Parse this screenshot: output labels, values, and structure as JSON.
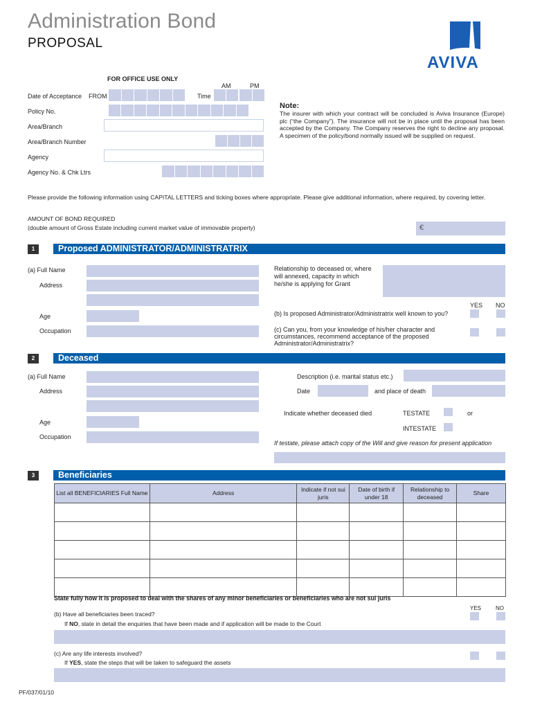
{
  "header": {
    "title": "Administration Bond",
    "subtitle": "PROPOSAL",
    "logo_text": "AVIVA",
    "brand_color": "#1a5fb4"
  },
  "office_use": {
    "heading": "FOR OFFICE USE ONLY",
    "date_of_acceptance_label": "Date of Acceptance",
    "from_label": "FROM",
    "time_label": "Time",
    "am_label": "AM",
    "pm_label": "PM",
    "policy_no_label": "Policy No.",
    "area_branch_label": "Area/Branch",
    "area_branch_number_label": "Area/Branch Number",
    "agency_label": "Agency",
    "agency_no_label": "Agency No. & Chk Ltrs"
  },
  "note": {
    "heading": "Note:",
    "body": "The insurer with which your contract will be concluded is Aviva Insurance (Europe) plc (“the Company”). The insurance will not be in place until the proposal has been accepted by the Company. The Company reserves the right to decline any proposal. A specimen of the policy/bond normally issued will be supplied on request."
  },
  "intro": {
    "text": "Please provide the following information using CAPITAL LETTERS and ticking boxes where appropriate. Please give additional information, where required, by covering letter.",
    "bond_amount_label": "AMOUNT OF BOND REQUIRED",
    "bond_amount_sub": "(double amount of Gross Estate including current market value of immovable property)",
    "currency_symbol": "€"
  },
  "section1": {
    "number": "1",
    "title": "Proposed ADMINISTRATOR/ADMINISTRATRIX",
    "full_name_label": "(a)  Full Name",
    "address_label": "Address",
    "age_label": "Age",
    "occupation_label": "Occupation",
    "relationship_label": "Relationship to deceased or, where will annexed, capacity in which he/she is applying for Grant",
    "yes_label": "YES",
    "no_label": "NO",
    "q_b": "(b) Is proposed Administrator/Administratrix well known to you?",
    "q_c": "(c) Can you, from your knowledge of his/her character and circumstances, recommend acceptance of the proposed Administrator/Administratrix?"
  },
  "section2": {
    "number": "2",
    "title": "Deceased",
    "full_name_label": "(a)  Full Name",
    "address_label": "Address",
    "age_label": "Age",
    "occupation_label": "Occupation",
    "description_label": "Description (i.e. marital status etc.)",
    "date_label": "Date",
    "place_label": "and place of death",
    "indicate_label": "Indicate whether deceased died",
    "testate_label": "TESTATE",
    "or_label": "or",
    "intestate_label": "INTESTATE",
    "testate_note": "If testate, please attach copy of the Will and give reason for present application"
  },
  "section3": {
    "number": "3",
    "title": "Beneficiaries",
    "columns": [
      "List all BENEFICIARIES Full Name",
      "Address",
      "Indicate if not sui juris",
      "Date of birth if under 18",
      "Relationship to deceased",
      "Share"
    ],
    "row_count": 5,
    "minor_statement": "State fully how it is proposed to deal with the shares of any minor beneficiaries or beneficiaries who are not sui juris",
    "yes_label": "YES",
    "no_label": "NO",
    "q_b": "(b)  Have all beneficiaries been traced?",
    "q_b_follow_prefix": "If ",
    "q_b_follow_bold": "NO",
    "q_b_follow_rest": ", state in detail the enquiries that have been made and if application will be made to the Court",
    "q_c": "(c)  Are any life interests involved?",
    "q_c_follow_prefix": "If ",
    "q_c_follow_bold": "YES",
    "q_c_follow_rest": ", state the steps that will be taken to safeguard the assets"
  },
  "footer": {
    "form_code": "PF/037/01/10"
  }
}
